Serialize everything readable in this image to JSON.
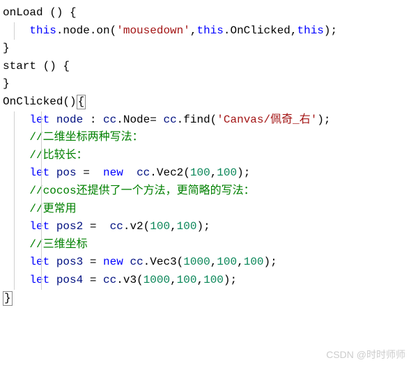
{
  "code": {
    "l1_onload": "onLoad",
    "l1_rest": " () {",
    "l2_indent": "    ",
    "l2_this": "this",
    "l2_dot_node_on": ".node.on(",
    "l2_str": "'mousedown'",
    "l2_comma1": ",",
    "l2_this2": "this",
    "l2_dot_onclicked": ".OnClicked,",
    "l2_this3": "this",
    "l2_close": ");",
    "l3": "}",
    "l4": "",
    "l5_start": "start",
    "l5_rest": " () {",
    "l6": "",
    "l7": "}",
    "l8_onclicked": "OnClicked",
    "l8_paren": "()",
    "l8_brace": "{",
    "l9_indent": "    ",
    "l9_let": "let",
    "l9_sp": " ",
    "l9_node": "node",
    "l9_colon": " : ",
    "l9_cc1": "cc",
    "l9_dot_node": ".Node= ",
    "l9_cc2": "cc",
    "l9_find": ".find(",
    "l9_str": "'Canvas/佩奇_右'",
    "l9_close": ");",
    "l10_indent": "    ",
    "l10_comment": "//二维坐标两种写法：",
    "l11_indent": "    ",
    "l11_comment": "//比较长：",
    "l12_indent": "    ",
    "l12_let": "let",
    "l12_sp": " ",
    "l12_pos": "pos",
    "l12_eq": " =  ",
    "l12_new": "new",
    "l12_sp2": "  ",
    "l12_cc": "cc",
    "l12_vec2": ".Vec2(",
    "l12_n1": "100",
    "l12_comma": ",",
    "l12_n2": "100",
    "l12_close": ");",
    "l13_indent": "    ",
    "l13_comment": "//cocos还提供了一个方法，更简略的写法：",
    "l14_indent": "    ",
    "l14_comment": "//更常用",
    "l15_indent": "    ",
    "l15_let": "let",
    "l15_sp": " ",
    "l15_pos2": "pos2",
    "l15_eq": " =  ",
    "l15_cc": "cc",
    "l15_v2": ".v2(",
    "l15_n1": "100",
    "l15_comma": ",",
    "l15_n2": "100",
    "l15_close": ");",
    "l16_indent": "    ",
    "l16_comment": "//三维坐标",
    "l17_indent": "    ",
    "l17_let": "let",
    "l17_sp": " ",
    "l17_pos3": "pos3",
    "l17_eq": " = ",
    "l17_new": "new",
    "l17_sp2": " ",
    "l17_cc": "cc",
    "l17_vec3": ".Vec3(",
    "l17_n1": "1000",
    "l17_c1": ",",
    "l17_n2": "100",
    "l17_c2": ",",
    "l17_n3": "100",
    "l17_close": ");",
    "l18_indent": "    ",
    "l18_let": "let",
    "l18_sp": " ",
    "l18_pos4": "pos4",
    "l18_eq": " = ",
    "l18_cc": "cc",
    "l18_v3": ".v3(",
    "l18_n1": "1000",
    "l18_c1": ",",
    "l18_n2": "100",
    "l18_c2": ",",
    "l18_n3": "100",
    "l18_close": ");",
    "l19_brace": "}"
  },
  "watermark": "CSDN @时时师师"
}
